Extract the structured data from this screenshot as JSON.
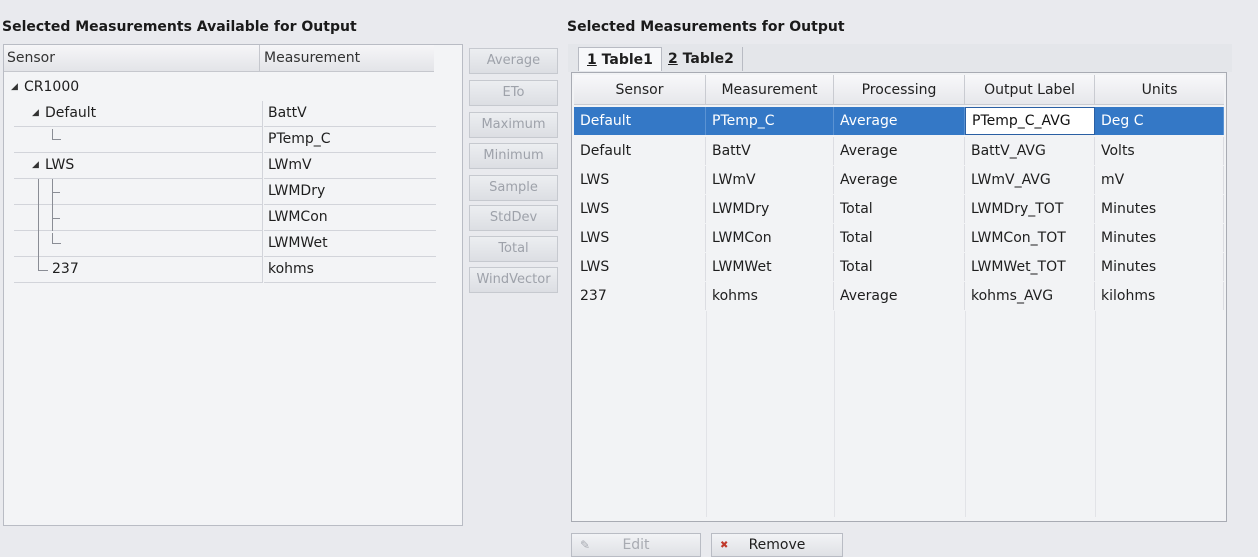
{
  "left_panel": {
    "title": "Selected Measurements Available for Output",
    "columns": [
      "Sensor",
      "Measurement"
    ],
    "rows": [
      {
        "sensor": "CR1000",
        "measurement": "",
        "expanded": true
      },
      {
        "sensor": "Default",
        "measurement": "BattV",
        "expanded": true
      },
      {
        "sensor": "",
        "measurement": "PTemp_C"
      },
      {
        "sensor": "LWS",
        "measurement": "LWmV",
        "expanded": true
      },
      {
        "sensor": "",
        "measurement": "LWMDry"
      },
      {
        "sensor": "",
        "measurement": "LWMCon"
      },
      {
        "sensor": "",
        "measurement": "LWMWet"
      },
      {
        "sensor": "237",
        "measurement": "kohms"
      }
    ]
  },
  "processing_buttons": [
    "Average",
    "ETo",
    "Maximum",
    "Minimum",
    "Sample",
    "StdDev",
    "Total",
    "WindVector"
  ],
  "right_panel": {
    "title": "Selected Measurements for Output",
    "tabs": [
      {
        "num": "1",
        "label": " Table1"
      },
      {
        "num": "2",
        "label": " Table2"
      }
    ],
    "columns": [
      "Sensor",
      "Measurement",
      "Processing",
      "Output Label",
      "Units"
    ],
    "rows": [
      {
        "sensor": "Default",
        "measurement": "PTemp_C",
        "processing": "Average",
        "output_label": "PTemp_C_AVG",
        "units": "Deg C",
        "selected": true
      },
      {
        "sensor": "Default",
        "measurement": "BattV",
        "processing": "Average",
        "output_label": "BattV_AVG",
        "units": "Volts"
      },
      {
        "sensor": "LWS",
        "measurement": "LWmV",
        "processing": "Average",
        "output_label": "LWmV_AVG",
        "units": "mV"
      },
      {
        "sensor": "LWS",
        "measurement": "LWMDry",
        "processing": "Total",
        "output_label": "LWMDry_TOT",
        "units": "Minutes"
      },
      {
        "sensor": "LWS",
        "measurement": "LWMCon",
        "processing": "Total",
        "output_label": "LWMCon_TOT",
        "units": "Minutes"
      },
      {
        "sensor": "LWS",
        "measurement": "LWMWet",
        "processing": "Total",
        "output_label": "LWMWet_TOT",
        "units": "Minutes"
      },
      {
        "sensor": "237",
        "measurement": "kohms",
        "processing": "Average",
        "output_label": "kohms_AVG",
        "units": "kilohms"
      }
    ]
  },
  "bottom_buttons": {
    "edit": "Edit",
    "remove": "Remove",
    "edit_icon": "pencil-icon",
    "remove_icon": "remove-x-icon"
  },
  "colors": {
    "selection": "#3478c6",
    "background": "#e9eaee"
  }
}
